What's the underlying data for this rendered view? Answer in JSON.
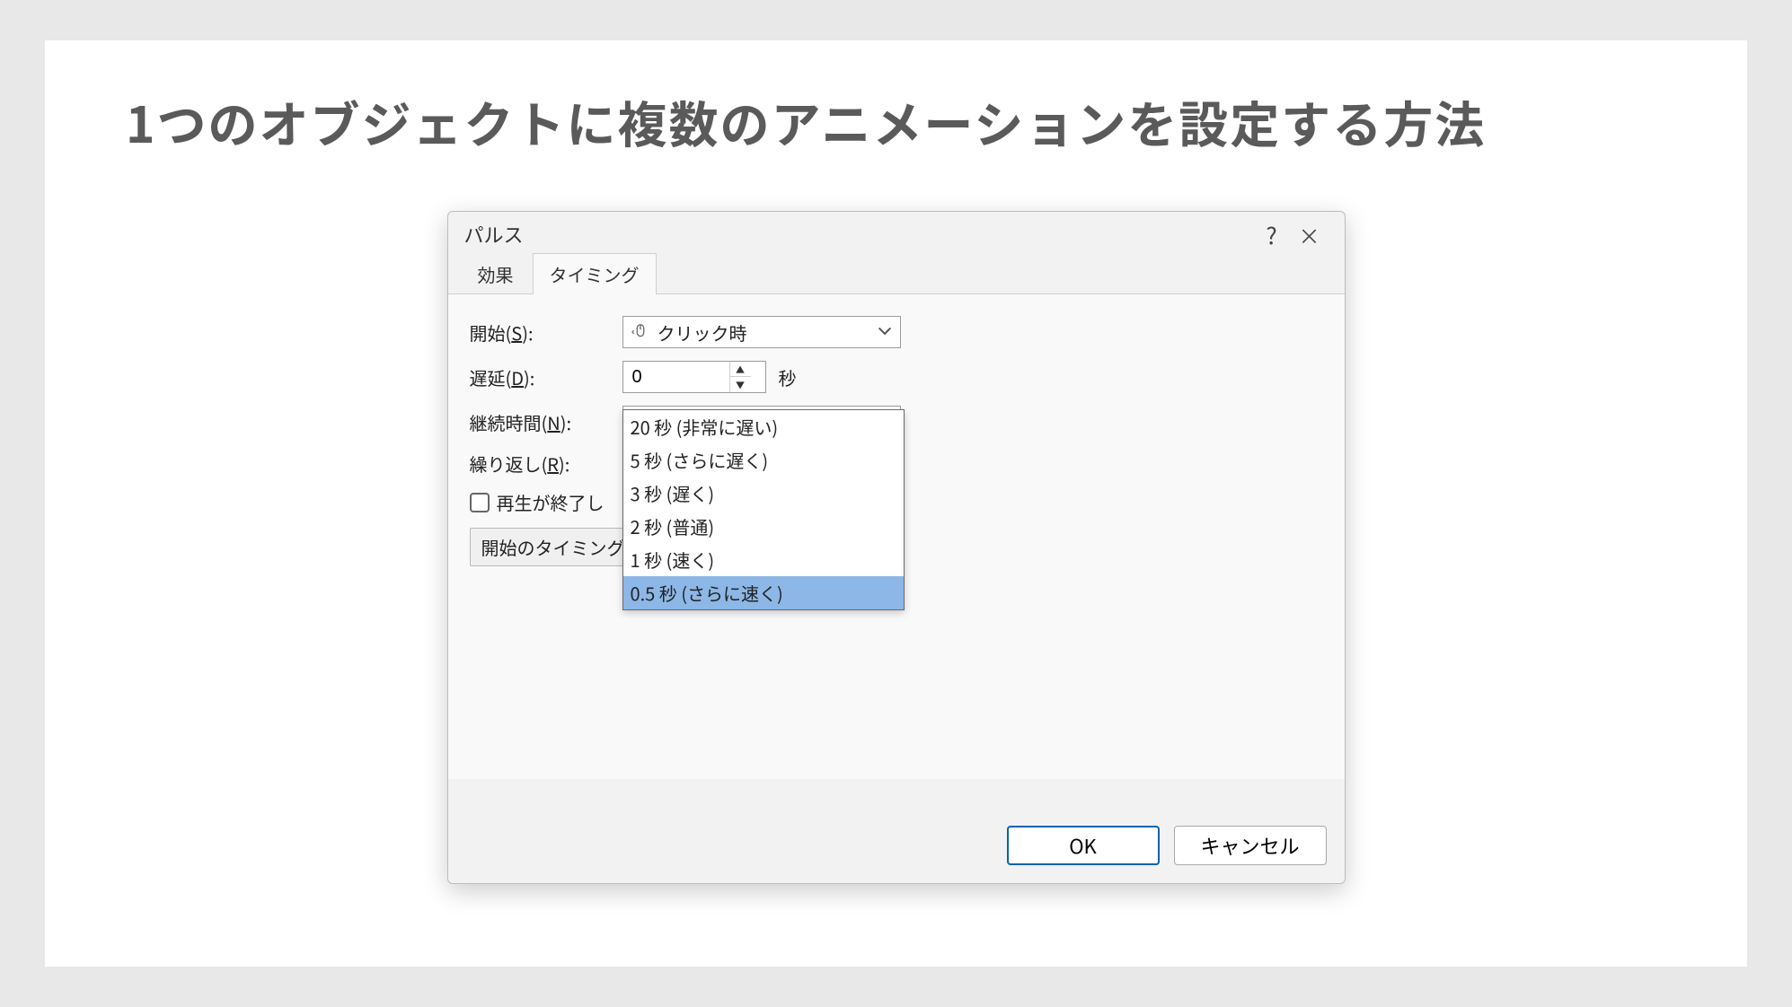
{
  "page": {
    "title": "1つのオブジェクトに複数のアニメーションを設定する方法"
  },
  "dialog": {
    "title": "パルス",
    "help_icon": "?",
    "close_icon": "×",
    "tabs": [
      {
        "label": "効果",
        "active": false
      },
      {
        "label": "タイミング",
        "active": true
      }
    ],
    "labels": {
      "start_pre": "開始(",
      "start_u": "S",
      "start_post": "):",
      "delay_pre": "遅延(",
      "delay_u": "D",
      "delay_post": "):",
      "duration_pre": "継続時間(",
      "duration_u": "N",
      "duration_post": "):",
      "repeat_pre": "繰り返し(",
      "repeat_u": "R",
      "repeat_post": "):",
      "rewind": "再生が終了し",
      "timing_btn": "開始のタイミング("
    },
    "values": {
      "start": "クリック時",
      "delay": "0",
      "delay_unit": "秒",
      "duration_selected": "0.5 秒 (さらに速く)"
    },
    "duration_options": [
      "20 秒 (非常に遅い)",
      "5 秒 (さらに遅く)",
      "3 秒 (遅く)",
      "2 秒 (普通)",
      "1 秒 (速く)",
      "0.5 秒 (さらに速く)"
    ],
    "duration_selected_index": 5,
    "buttons": {
      "ok": "OK",
      "cancel": "キャンセル"
    }
  }
}
